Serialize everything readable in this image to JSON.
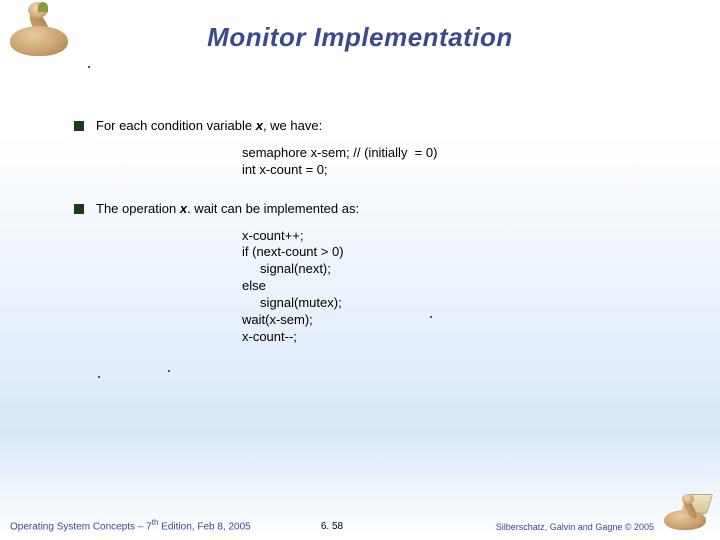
{
  "title": "Monitor Implementation",
  "bullets": [
    {
      "prefix": "For each condition variable ",
      "var": "x",
      "suffix": ", we  have:"
    },
    {
      "prefix": "The operation ",
      "var": "x",
      "mid": ". wait",
      "suffix": " can be implemented as:"
    }
  ],
  "code1": "semaphore x-sem; // (initially  = 0)\nint x-count = 0;",
  "code2": "x-count++;\nif (next-count > 0)\n     signal(next);\nelse\n     signal(mutex);\nwait(x-sem);\nx-count--;",
  "footer": {
    "left_prefix": "Operating System Concepts – 7",
    "left_sup": "th",
    "left_suffix": " Edition, Feb 8, 2005",
    "center": "6. 58",
    "right": "Silberschatz, Galvin and Gagne © 2005"
  }
}
